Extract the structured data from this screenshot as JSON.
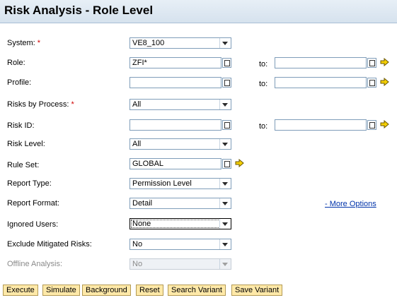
{
  "header": {
    "title": "Risk Analysis - Role Level"
  },
  "form": {
    "system": {
      "label": "System:",
      "value": "VE8_100"
    },
    "role": {
      "label": "Role:",
      "value": "ZFI*",
      "to_label": "to:",
      "to_value": ""
    },
    "profile": {
      "label": "Profile:",
      "value": "",
      "to_label": "to:",
      "to_value": ""
    },
    "risks_by_process": {
      "label": "Risks by Process:",
      "value": "All"
    },
    "risk_id": {
      "label": "Risk ID:",
      "value": "",
      "to_label": "to:",
      "to_value": ""
    },
    "risk_level": {
      "label": "Risk Level:",
      "value": "All"
    },
    "rule_set": {
      "label": "Rule Set:",
      "value": "GLOBAL"
    },
    "report_type": {
      "label": "Report Type:",
      "value": "Permission Level"
    },
    "report_format": {
      "label": "Report Format:",
      "value": "Detail"
    },
    "ignored_users": {
      "label": "Ignored Users:",
      "value": "None"
    },
    "exclude_mitigated": {
      "label": "Exclude Mitigated Risks:",
      "value": "No"
    },
    "offline_analysis": {
      "label": "Offline Analysis:",
      "value": "No"
    },
    "required_marker": "*",
    "more_options": "- More Options"
  },
  "buttons": {
    "execute": "Execute",
    "simulate": "Simulate",
    "background": "Background",
    "reset": "Reset",
    "search_variant": "Search Variant",
    "save_variant": "Save Variant"
  },
  "colors": {
    "header_bg": "#dde7f1",
    "required": "#d00000",
    "link": "#0033aa",
    "button_bg": "#ffe9a8"
  }
}
